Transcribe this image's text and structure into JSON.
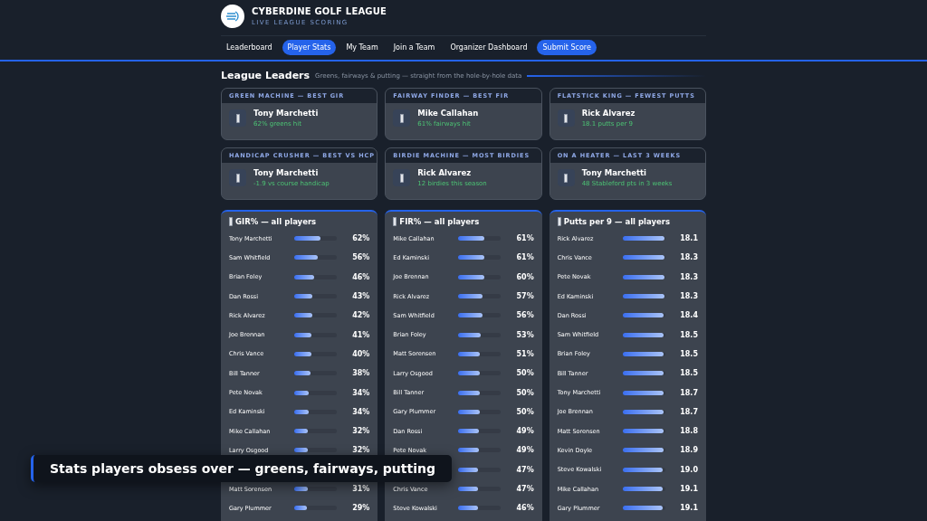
{
  "brand": {
    "title": "CYBERDINE GOLF LEAGUE",
    "subtitle": "LIVE LEAGUE SCORING"
  },
  "nav": [
    {
      "label": "Leaderboard",
      "selected": false
    },
    {
      "label": "Player Stats",
      "selected": true
    },
    {
      "label": "My Team",
      "selected": false
    },
    {
      "label": "Join a Team",
      "selected": false
    },
    {
      "label": "Organizer Dashboard",
      "selected": false
    }
  ],
  "submit_button": {
    "label": "Submit Score"
  },
  "section": {
    "title": "League Leaders",
    "subtitle": "Greens, fairways & putting — straight from the hole-by-hole data"
  },
  "leaders": [
    {
      "label": "GREEN MACHINE — BEST GIR",
      "name": "Tony Marchetti",
      "stat": "62% greens hit"
    },
    {
      "label": "FAIRWAY FINDER — BEST FIR",
      "name": "Mike Callahan",
      "stat": "61% fairways hit"
    },
    {
      "label": "FLATSTICK KING — FEWEST PUTTS",
      "name": "Rick Alvarez",
      "stat": "18.1 putts per 9"
    },
    {
      "label": "HANDICAP CRUSHER — BEST VS HCP",
      "name": "Tony Marchetti",
      "stat": "-1.9 vs course handicap"
    },
    {
      "label": "BIRDIE MACHINE — MOST BIRDIES",
      "name": "Rick Alvarez",
      "stat": "12 birdies this season"
    },
    {
      "label": "ON A HEATER — LAST 3 WEEKS",
      "name": "Tony Marchetti",
      "stat": "48 Stableford pts in 3 weeks"
    }
  ],
  "panels": [
    {
      "title": "GIR% — all players",
      "rows": [
        {
          "name": "Tony Marchetti",
          "value": "62%",
          "level": 0.62
        },
        {
          "name": "Sam Whitfield",
          "value": "56%",
          "level": 0.56
        },
        {
          "name": "Brian Foley",
          "value": "46%",
          "level": 0.46
        },
        {
          "name": "Dan Rossi",
          "value": "43%",
          "level": 0.43
        },
        {
          "name": "Rick Alvarez",
          "value": "42%",
          "level": 0.42
        },
        {
          "name": "Joe Brennan",
          "value": "41%",
          "level": 0.41
        },
        {
          "name": "Chris Vance",
          "value": "40%",
          "level": 0.4
        },
        {
          "name": "Bill Tanner",
          "value": "38%",
          "level": 0.38
        },
        {
          "name": "Pete Novak",
          "value": "34%",
          "level": 0.34
        },
        {
          "name": "Ed Kaminski",
          "value": "34%",
          "level": 0.34
        },
        {
          "name": "Mike Callahan",
          "value": "32%",
          "level": 0.32
        },
        {
          "name": "Larry Osgood",
          "value": "32%",
          "level": 0.32
        },
        {},
        {
          "name": "Matt Sorensen",
          "value": "31%",
          "level": 0.31
        },
        {
          "name": "Gary Plummer",
          "value": "29%",
          "level": 0.29
        }
      ]
    },
    {
      "title": "FIR% — all players",
      "rows": [
        {
          "name": "Mike Callahan",
          "value": "61%",
          "level": 0.61
        },
        {
          "name": "Ed Kaminski",
          "value": "61%",
          "level": 0.61
        },
        {
          "name": "Joe Brennan",
          "value": "60%",
          "level": 0.6
        },
        {
          "name": "Rick Alvarez",
          "value": "57%",
          "level": 0.57
        },
        {
          "name": "Sam Whitfield",
          "value": "56%",
          "level": 0.56
        },
        {
          "name": "Brian Foley",
          "value": "53%",
          "level": 0.53
        },
        {
          "name": "Matt Sorensen",
          "value": "51%",
          "level": 0.51
        },
        {
          "name": "Larry Osgood",
          "value": "50%",
          "level": 0.5
        },
        {
          "name": "Bill Tanner",
          "value": "50%",
          "level": 0.5
        },
        {
          "name": "Gary Plummer",
          "value": "50%",
          "level": 0.5
        },
        {
          "name": "Dan Rossi",
          "value": "49%",
          "level": 0.49
        },
        {
          "name": "Pete Novak",
          "value": "49%",
          "level": 0.49
        },
        {
          "value": "47%",
          "level": 0.47
        },
        {
          "name": "Chris Vance",
          "value": "47%",
          "level": 0.47
        },
        {
          "name": "Steve Kowalski",
          "value": "46%",
          "level": 0.46
        }
      ]
    },
    {
      "title": "Putts per 9 — all players",
      "rows": [
        {
          "name": "Rick Alvarez",
          "value": "18.1",
          "level": 0.99
        },
        {
          "name": "Chris Vance",
          "value": "18.3",
          "level": 0.98
        },
        {
          "name": "Pete Novak",
          "value": "18.3",
          "level": 0.98
        },
        {
          "name": "Ed Kaminski",
          "value": "18.3",
          "level": 0.98
        },
        {
          "name": "Dan Rossi",
          "value": "18.4",
          "level": 0.97
        },
        {
          "name": "Sam Whitfield",
          "value": "18.5",
          "level": 0.97
        },
        {
          "name": "Brian Foley",
          "value": "18.5",
          "level": 0.97
        },
        {
          "name": "Bill Tanner",
          "value": "18.5",
          "level": 0.97
        },
        {
          "name": "Tony Marchetti",
          "value": "18.7",
          "level": 0.96
        },
        {
          "name": "Joe Brennan",
          "value": "18.7",
          "level": 0.96
        },
        {
          "name": "Matt Sorensen",
          "value": "18.8",
          "level": 0.96
        },
        {
          "name": "Kevin Doyle",
          "value": "18.9",
          "level": 0.96
        },
        {
          "name": "Steve Kowalski",
          "value": "19.0",
          "level": 0.95
        },
        {
          "name": "Mike Callahan",
          "value": "19.1",
          "level": 0.95
        },
        {
          "name": "Gary Plummer",
          "value": "19.1",
          "level": 0.95
        }
      ]
    }
  ],
  "caption": "Stats players obsess over — greens, fairways, putting"
}
